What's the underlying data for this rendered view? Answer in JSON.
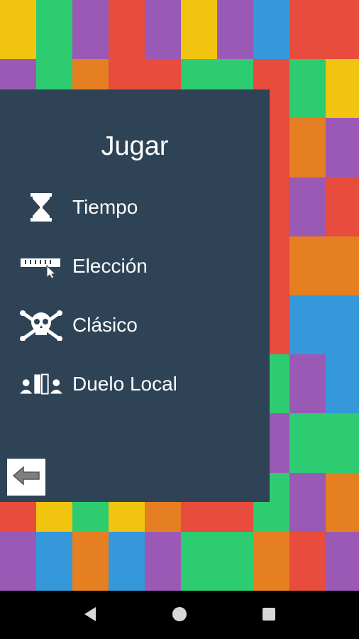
{
  "menu": {
    "title": "Jugar",
    "items": [
      {
        "label": "Tiempo",
        "icon": "hourglass-icon"
      },
      {
        "label": "Elección",
        "icon": "ruler-cursor-icon"
      },
      {
        "label": "Clásico",
        "icon": "skull-crossbones-icon"
      },
      {
        "label": "Duelo Local",
        "icon": "duel-players-icon"
      }
    ],
    "back_icon": "back-arrow-icon"
  },
  "navbar": {
    "icons": [
      "back-triangle-icon",
      "home-circle-icon",
      "recents-square-icon"
    ]
  },
  "colors": {
    "panel": "#2e4356",
    "red": "#e74c3c",
    "green": "#2ecc71",
    "purple": "#9b59b6",
    "yellow": "#f1c40f",
    "blue": "#3498db",
    "orange": "#e67e22"
  },
  "board_grid": [
    [
      "yellow",
      "green",
      "purple",
      "red",
      "purple",
      "yellow",
      "purple",
      "blue",
      "red",
      "red"
    ],
    [
      "purple",
      "green",
      "orange",
      "red",
      "red",
      "green",
      "green",
      "red",
      "green",
      "yellow"
    ],
    [
      "red",
      "red",
      "red",
      "red",
      "red",
      "red",
      "red",
      "red",
      "orange",
      "purple"
    ],
    [
      "red",
      "red",
      "red",
      "red",
      "red",
      "red",
      "red",
      "red",
      "purple",
      "red"
    ],
    [
      "red",
      "red",
      "red",
      "red",
      "red",
      "red",
      "red",
      "red",
      "orange",
      "orange"
    ],
    [
      "red",
      "red",
      "red",
      "red",
      "red",
      "red",
      "red",
      "red",
      "blue",
      "blue"
    ],
    [
      "red",
      "red",
      "red",
      "red",
      "red",
      "red",
      "red",
      "green",
      "purple",
      "blue"
    ],
    [
      "red",
      "red",
      "red",
      "red",
      "red",
      "red",
      "red",
      "purple",
      "green",
      "green"
    ],
    [
      "red",
      "yellow",
      "green",
      "yellow",
      "orange",
      "red",
      "red",
      "green",
      "purple",
      "orange"
    ],
    [
      "purple",
      "blue",
      "orange",
      "blue",
      "purple",
      "green",
      "green",
      "orange",
      "red",
      "purple"
    ]
  ]
}
